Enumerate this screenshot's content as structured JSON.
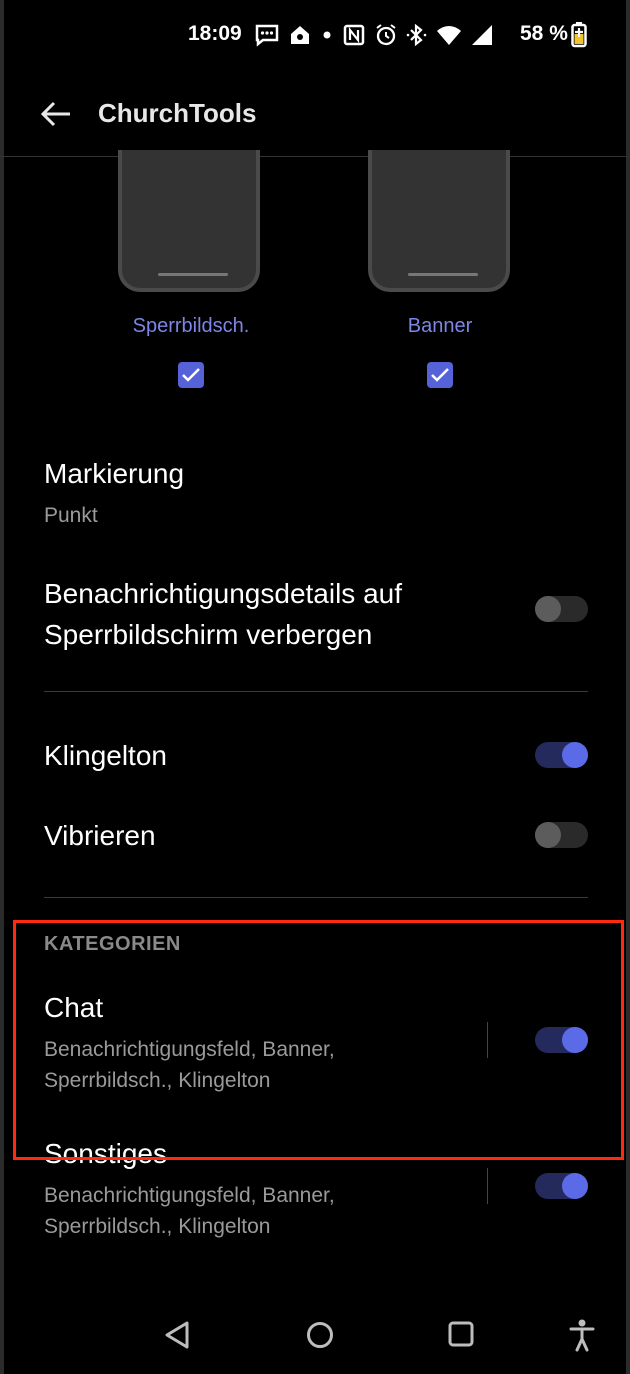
{
  "status_bar": {
    "time": "18:09",
    "battery": "58 %"
  },
  "app_bar": {
    "title": "ChurchTools"
  },
  "previews": [
    {
      "label": "Sperrbildsch.",
      "checked": true
    },
    {
      "label": "Banner",
      "checked": true
    }
  ],
  "settings": {
    "markierung": {
      "title": "Markierung",
      "value": "Punkt"
    },
    "hide_details": {
      "title_line1": "Benachrichtigungsdetails auf",
      "title_line2": "Sperrbildschirm verbergen",
      "on": false
    },
    "klingelton": {
      "title": "Klingelton",
      "on": true
    },
    "vibrieren": {
      "title": "Vibrieren",
      "on": false
    }
  },
  "categories": {
    "header": "KATEGORIEN",
    "items": [
      {
        "title": "Chat",
        "line1": "Benachrichtigungsfeld, Banner,",
        "line2": "Sperrbildsch., Klingelton",
        "on": true
      },
      {
        "title": "Sonstiges",
        "line1": "Benachrichtigungsfeld, Banner,",
        "line2": "Sperrbildsch., Klingelton",
        "on": true
      }
    ]
  },
  "colors": {
    "accent": "#5b6ae6",
    "highlight": "#ff2a10"
  }
}
